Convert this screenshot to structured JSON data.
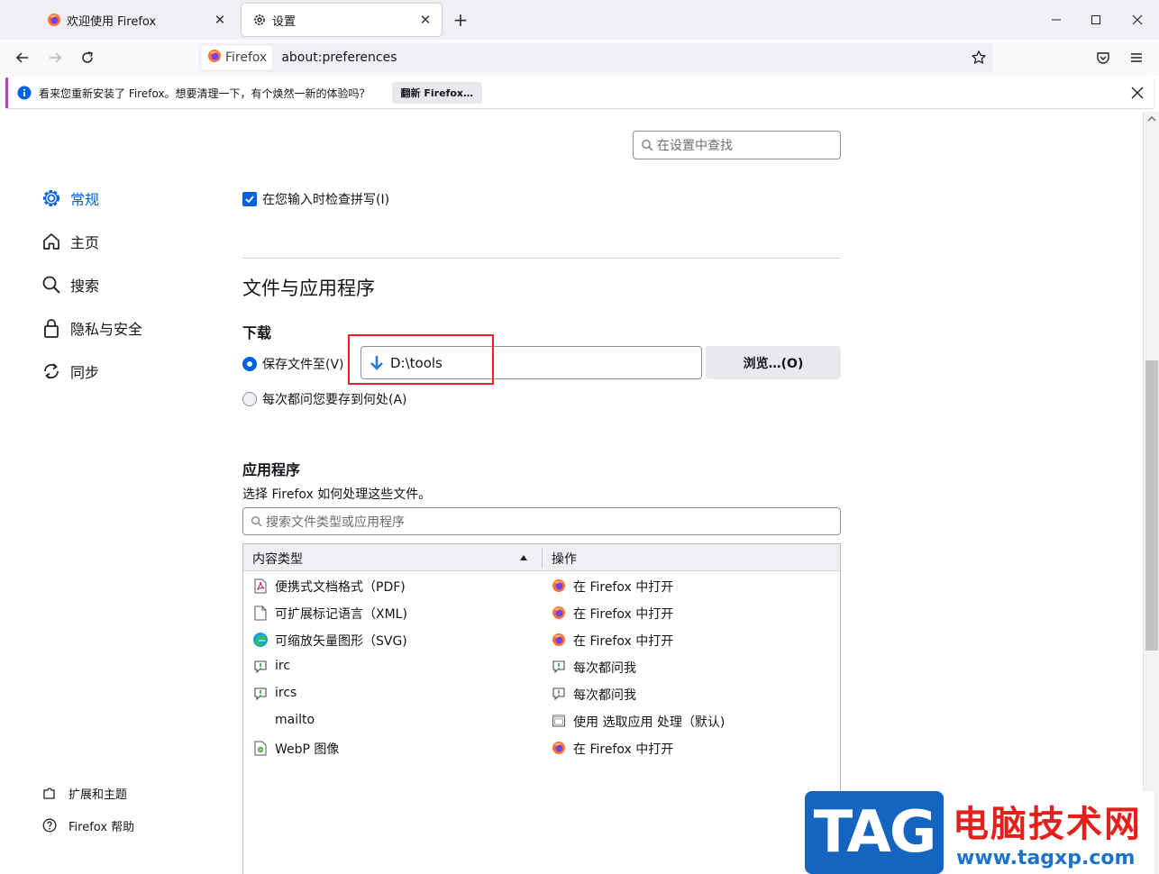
{
  "tabs": [
    {
      "title": "欢迎使用 Firefox",
      "icon": "firefox-icon"
    },
    {
      "title": "设置",
      "icon": "gear-icon",
      "active": true
    }
  ],
  "urlbar": {
    "identity": "Firefox",
    "url": "about:preferences"
  },
  "notification": {
    "message": "看来您重新安装了 Firefox。想要清理一下，有个焕然一新的体验吗？",
    "button": "翻新 Firefox…"
  },
  "sidebar": {
    "items": [
      {
        "label": "常规",
        "icon": "gear-icon",
        "selected": true
      },
      {
        "label": "主页",
        "icon": "home-icon"
      },
      {
        "label": "搜索",
        "icon": "search-icon"
      },
      {
        "label": "隐私与安全",
        "icon": "lock-icon"
      },
      {
        "label": "同步",
        "icon": "sync-icon"
      }
    ],
    "footer": [
      {
        "label": "扩展和主题",
        "icon": "puzzle-icon"
      },
      {
        "label": "Firefox 帮助",
        "icon": "help-icon"
      }
    ]
  },
  "search": {
    "placeholder": "在设置中查找"
  },
  "spellcheck": {
    "label": "在您输入时检查拼写(I)",
    "checked": true
  },
  "files_section": {
    "title": "文件与应用程序",
    "downloads": {
      "heading": "下载",
      "save_to_label": "保存文件至(V)",
      "path": "D:\\tools",
      "browse_button": "浏览…(O)",
      "always_ask_label": "每次都问您要存到何处(A)",
      "selected_option": "save_to"
    },
    "applications": {
      "heading": "应用程序",
      "description": "选择 Firefox 如何处理这些文件。",
      "filter_placeholder": "搜索文件类型或应用程序",
      "columns": [
        "内容类型",
        "操作"
      ],
      "rows": [
        {
          "type": "便携式文档格式（PDF)",
          "type_icon": "pdf-file-icon",
          "action": "在 Firefox 中打开",
          "action_icon": "firefox-icon"
        },
        {
          "type": "可扩展标记语言（XML)",
          "type_icon": "blank-file-icon",
          "action": "在 Firefox 中打开",
          "action_icon": "firefox-icon"
        },
        {
          "type": "可缩放矢量图形（SVG)",
          "type_icon": "edge-icon",
          "action": "在 Firefox 中打开",
          "action_icon": "firefox-icon"
        },
        {
          "type": "irc",
          "type_icon": "chat-icon",
          "action": "每次都问我",
          "action_icon": "chat-icon"
        },
        {
          "type": "ircs",
          "type_icon": "chat-icon",
          "action": "每次都问我",
          "action_icon": "chat-icon"
        },
        {
          "type": "mailto",
          "type_icon": "",
          "action": "使用 选取应用 处理（默认)",
          "action_icon": "app-window-icon"
        },
        {
          "type": "WebP 图像",
          "type_icon": "image-file-icon",
          "action": "在 Firefox 中打开",
          "action_icon": "firefox-icon"
        }
      ]
    }
  },
  "watermark": {
    "logo": "TAG",
    "site_name": "电脑技术网",
    "url": "www.tagxp.com"
  },
  "colors": {
    "accent": "#0061e0",
    "notification_bar": "#c43ec4",
    "highlight_box": "#e8202a"
  }
}
